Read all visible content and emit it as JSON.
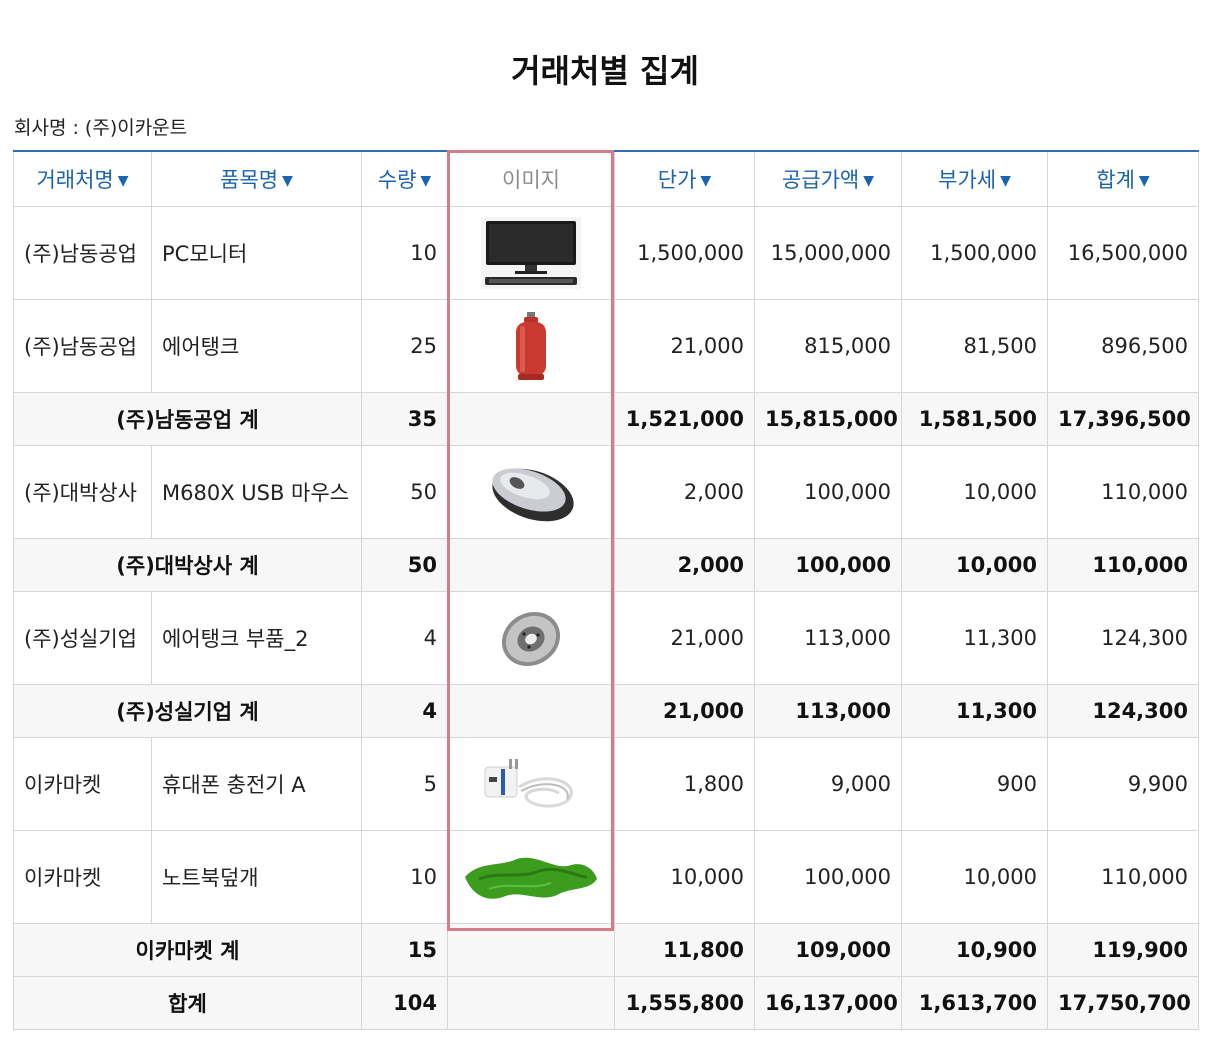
{
  "title": "거래처별 집계",
  "company": "회사명 : (주)이카운트",
  "headers": {
    "vendor": "거래처명",
    "item": "품목명",
    "qty": "수량",
    "image": "이미지",
    "unit_price": "단가",
    "supply": "공급가액",
    "vat": "부가세",
    "total": "합계",
    "sort_arrow": "▼"
  },
  "rows": [
    {
      "vendor": "(주)남동공업",
      "item": "PC모니터",
      "qty": "10",
      "image": "monitor-image",
      "unit_price": "1,500,000",
      "supply": "15,000,000",
      "vat": "1,500,000",
      "total": "16,500,000"
    },
    {
      "vendor": "(주)남동공업",
      "item": "에어탱크",
      "qty": "25",
      "image": "gas-tank-image",
      "unit_price": "21,000",
      "supply": "815,000",
      "vat": "81,500",
      "total": "896,500"
    },
    {
      "subtotal": "(주)남동공업 계",
      "qty": "35",
      "unit_price": "1,521,000",
      "supply": "15,815,000",
      "vat": "1,581,500",
      "total": "17,396,500"
    },
    {
      "vendor": "(주)대박상사",
      "item": "M680X USB 마우스",
      "qty": "50",
      "image": "mouse-image",
      "unit_price": "2,000",
      "supply": "100,000",
      "vat": "10,000",
      "total": "110,000"
    },
    {
      "subtotal": "(주)대박상사 계",
      "qty": "50",
      "unit_price": "2,000",
      "supply": "100,000",
      "vat": "10,000",
      "total": "110,000"
    },
    {
      "vendor": "(주)성실기업",
      "item": "에어탱크 부품_2",
      "qty": "4",
      "image": "brake-disc-image",
      "unit_price": "21,000",
      "supply": "113,000",
      "vat": "11,300",
      "total": "124,300"
    },
    {
      "subtotal": "(주)성실기업 계",
      "qty": "4",
      "unit_price": "21,000",
      "supply": "113,000",
      "vat": "11,300",
      "total": "124,300"
    },
    {
      "vendor": "이카마켓",
      "item": "휴대폰 충전기 A",
      "qty": "5",
      "image": "charger-image",
      "unit_price": "1,800",
      "supply": "9,000",
      "vat": "900",
      "total": "9,900"
    },
    {
      "vendor": "이카마켓",
      "item": "노트북덮개",
      "qty": "10",
      "image": "green-cloth-image",
      "unit_price": "10,000",
      "supply": "100,000",
      "vat": "10,000",
      "total": "110,000"
    },
    {
      "subtotal": "이카마켓 계",
      "qty": "15",
      "unit_price": "11,800",
      "supply": "109,000",
      "vat": "10,900",
      "total": "119,900"
    }
  ],
  "grand_total": {
    "label": "합계",
    "qty": "104",
    "unit_price": "1,555,800",
    "supply": "16,137,000",
    "vat": "1,613,700",
    "total": "17,750,700"
  },
  "colors": {
    "header_text": "#1b64b1",
    "header_border": "#2f6db5",
    "image_column_highlight": "#d57c89",
    "subtotal_bg": "#f7f7f7"
  }
}
